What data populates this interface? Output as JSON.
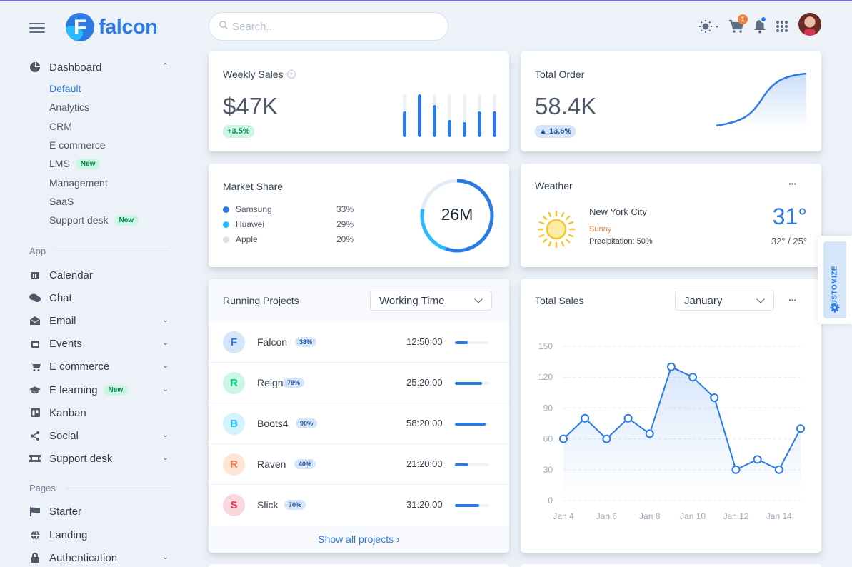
{
  "brand": {
    "name": "falcon",
    "mark": "F"
  },
  "search": {
    "placeholder": "Search..."
  },
  "header": {
    "cart_count": "1",
    "accent": "#2c7be5"
  },
  "sidebar": {
    "dashboard": {
      "label": "Dashboard",
      "icon": "pie-chart-icon"
    },
    "dashboard_items": [
      {
        "label": "Default",
        "active": true
      },
      {
        "label": "Analytics"
      },
      {
        "label": "CRM"
      },
      {
        "label": "E commerce"
      },
      {
        "label": "LMS",
        "badge": "New"
      },
      {
        "label": "Management"
      },
      {
        "label": "SaaS"
      },
      {
        "label": "Support desk",
        "badge": "New"
      }
    ],
    "section_app": "App",
    "app_items": [
      {
        "label": "Calendar",
        "icon": "calendar-icon"
      },
      {
        "label": "Chat",
        "icon": "chat-icon"
      },
      {
        "label": "Email",
        "icon": "envelope-icon"
      },
      {
        "label": "Events",
        "icon": "events-icon"
      },
      {
        "label": "E commerce",
        "icon": "cart-icon"
      },
      {
        "label": "E learning",
        "icon": "graduation-cap-icon",
        "badge": "New"
      },
      {
        "label": "Kanban",
        "icon": "kanban-icon"
      },
      {
        "label": "Social",
        "icon": "share-icon"
      },
      {
        "label": "Support desk",
        "icon": "ticket-icon"
      }
    ],
    "section_pages": "Pages",
    "page_items": [
      {
        "label": "Starter",
        "icon": "flag-icon"
      },
      {
        "label": "Landing",
        "icon": "globe-icon"
      },
      {
        "label": "Authentication",
        "icon": "lock-icon"
      }
    ]
  },
  "weekly_sales": {
    "title": "Weekly Sales",
    "value": "$47K",
    "change": "+3.5%",
    "bar_levels": [
      0.6,
      1.0,
      0.75,
      0.4,
      0.35,
      0.6,
      0.6
    ]
  },
  "total_order": {
    "title": "Total Order",
    "value": "58.4K",
    "change": "13.6%"
  },
  "market_share": {
    "title": "Market Share",
    "total": "26M",
    "items": [
      {
        "name": "Samsung",
        "pct": "33%",
        "color": "#2c7be5"
      },
      {
        "name": "Huawei",
        "pct": "29%",
        "color": "#27bcfd"
      },
      {
        "name": "Apple",
        "pct": "20%",
        "color": "#d8e2ef"
      }
    ]
  },
  "weather": {
    "title": "Weather",
    "city": "New York City",
    "condition": "Sunny",
    "precipitation": "Precipitation: 50%",
    "temp": "31°",
    "range": "32° / 25°"
  },
  "running_projects": {
    "title": "Running Projects",
    "filter": "Working Time",
    "footer": "Show all projects",
    "rows": [
      {
        "initial": "F",
        "name": "Falcon",
        "pct": "38%",
        "time": "12:50:00",
        "progress": 0.38,
        "bg": "#d5e5fa",
        "fg": "#2c7be5"
      },
      {
        "initial": "R",
        "name": "Reign",
        "pct": "79%",
        "time": "25:20:00",
        "progress": 0.79,
        "bg": "#ccf6e4",
        "fg": "#00d27a"
      },
      {
        "initial": "B",
        "name": "Boots4",
        "pct": "90%",
        "time": "58:20:00",
        "progress": 0.9,
        "bg": "#d4f2ff",
        "fg": "#27bcfd"
      },
      {
        "initial": "R",
        "name": "Raven",
        "pct": "40%",
        "time": "21:20:00",
        "progress": 0.4,
        "bg": "#fde6d8",
        "fg": "#f5803e"
      },
      {
        "initial": "S",
        "name": "Slick",
        "pct": "70%",
        "time": "31:20:00",
        "progress": 0.7,
        "bg": "#fad7dd",
        "fg": "#e63757"
      }
    ]
  },
  "total_sales": {
    "title": "Total Sales",
    "filter": "January"
  },
  "customize": {
    "label": "CUSTOMIZE"
  },
  "chart_data": {
    "type": "area",
    "title": "Total Sales",
    "x_ticks": [
      "Jan 4",
      "Jan 6",
      "Jan 8",
      "Jan 10",
      "Jan 12",
      "Jan 14"
    ],
    "x": [
      "Jan 4",
      "Jan 5",
      "Jan 6",
      "Jan 7",
      "Jan 8",
      "Jan 9",
      "Jan 10",
      "Jan 11",
      "Jan 12",
      "Jan 13",
      "Jan 14",
      "Jan 15"
    ],
    "values": [
      60,
      80,
      60,
      80,
      65,
      130,
      120,
      100,
      30,
      40,
      30,
      70
    ],
    "y_ticks": [
      "150",
      "120",
      "90",
      "60",
      "30",
      "0"
    ],
    "ylim": [
      0,
      150
    ],
    "grid": true
  }
}
